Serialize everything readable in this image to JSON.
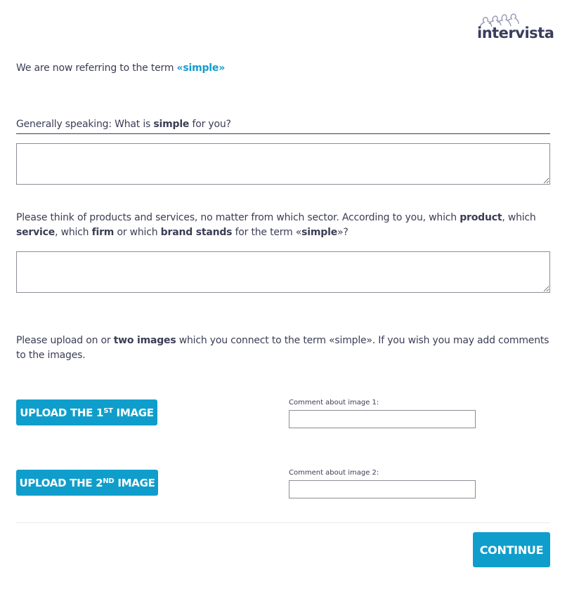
{
  "brand": {
    "logo_text": "intervista",
    "logo_icon": "people-silhouette-icon",
    "text_color": "#3a3d5c"
  },
  "colors": {
    "accent": "#0f9ecc",
    "text": "#3b3d55",
    "input_border": "#8c8c96"
  },
  "intro": {
    "text": "We are now referring to the term ",
    "term": "«simple»"
  },
  "question1": {
    "prefix": "Generally speaking: What is ",
    "bold": "simple",
    "suffix": " for you?",
    "value": ""
  },
  "question2": {
    "t1": "Please think of products and services, no matter from which sector. According to you, which ",
    "b1": "product",
    "t2": ", which ",
    "b2": "service",
    "t3": ", which ",
    "b3": "firm",
    "t4": " or which ",
    "b4": "brand stands",
    "t5": " for the term «",
    "b5": "simple",
    "t6": "»?",
    "value": ""
  },
  "question3": {
    "t1": "Please upload on or ",
    "b1": "two images",
    "t2": " which you connect to the term «simple». If you wish you may add comments to the images."
  },
  "uploads": [
    {
      "button_prefix": "UPLOAD THE 1",
      "button_sup": "ST",
      "button_suffix": " IMAGE",
      "comment_label": "Comment about image 1:",
      "comment_value": ""
    },
    {
      "button_prefix": "UPLOAD THE 2",
      "button_sup": "ND",
      "button_suffix": " IMAGE",
      "comment_label": "Comment about image 2:",
      "comment_value": ""
    }
  ],
  "footer": {
    "continue_label": "CONTINUE"
  }
}
